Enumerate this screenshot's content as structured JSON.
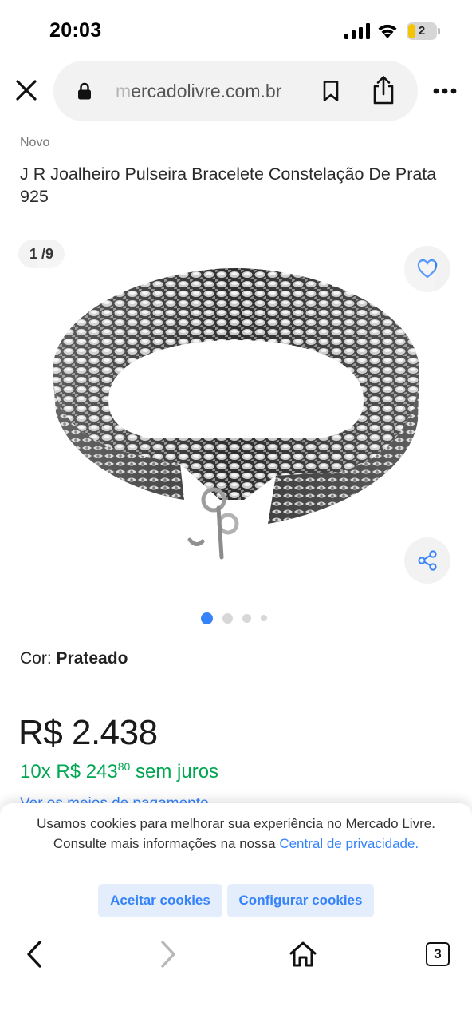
{
  "status_bar": {
    "time": "20:03",
    "battery_level": "2"
  },
  "browser": {
    "url_faded": "m",
    "url_main": "ercadolivre.com.br"
  },
  "product": {
    "condition": "Novo",
    "title": "J R Joalheiro Pulseira Bracelete Constelação De Prata 925",
    "gallery_counter": "1 /9",
    "gallery_total_dots": 4,
    "gallery_active_dot": 1,
    "color_label": "Cor:",
    "color_value": "Prateado",
    "price": "R$ 2.438",
    "installments_main": "10x R$ 243",
    "installments_cents": "80",
    "installments_suffix": " sem juros",
    "more_payment_link": "Ver os meios de pagamento"
  },
  "cookie_banner": {
    "text_before_link": "Usamos cookies para melhorar sua experiência no Mercado Livre. Consulte mais informações na nossa ",
    "link": "Central de privacidade.",
    "accept_label": "Aceitar cookies",
    "configure_label": "Configurar cookies"
  },
  "bottom_nav": {
    "tabs_count": "3"
  },
  "colors": {
    "accent_blue": "#3483fa",
    "success_green": "#00a650",
    "button_bg": "#e3edfb"
  },
  "icons": [
    "close-icon",
    "lock-icon",
    "bookmark-icon",
    "share-icon",
    "more-icon",
    "heart-icon",
    "share-nodes-icon",
    "back-icon",
    "forward-icon",
    "home-icon",
    "tabs-icon"
  ]
}
